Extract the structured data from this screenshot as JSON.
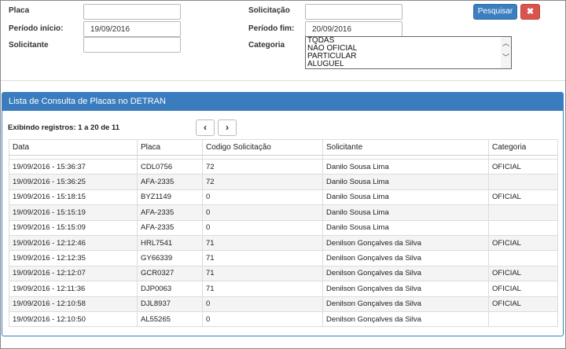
{
  "form": {
    "placa_label": "Placa",
    "placa_value": "",
    "periodo_inicio_label": "Período início:",
    "periodo_inicio_value": "19/09/2016",
    "solicitante_label": "Solicitante",
    "solicitante_value": "",
    "solicitacao_label": "Solicitação",
    "solicitacao_value": "",
    "periodo_fim_label": "Período fim:",
    "periodo_fim_value": "20/09/2016",
    "categoria_label": "Categoria",
    "categoria_options": [
      "TODAS",
      "NÃO OFICIAL",
      "PARTICULAR",
      "ALUGUEL"
    ],
    "search_label": "Pesquisar",
    "close_label": "✖"
  },
  "panel": {
    "title": "Lista de Consulta de Placas no DETRAN",
    "info": "Exibindo registros: 1 a 20 de 11",
    "prev_label": "‹",
    "next_label": "›"
  },
  "table": {
    "columns": [
      "Data",
      "Placa",
      "Codigo Solicitação",
      "Solicitante",
      "Categoria"
    ],
    "rows": [
      [
        "19/09/2016 - 15:36:37",
        "CDL0756",
        "72",
        "Danilo Sousa Lima",
        "OFICIAL"
      ],
      [
        "19/09/2016 - 15:36:25",
        "AFA-2335",
        "72",
        "Danilo Sousa Lima",
        ""
      ],
      [
        "19/09/2016 - 15:18:15",
        "BYZ1149",
        "0",
        "Danilo Sousa Lima",
        "OFICIAL"
      ],
      [
        "19/09/2016 - 15:15:19",
        "AFA-2335",
        "0",
        "Danilo Sousa Lima",
        ""
      ],
      [
        "19/09/2016 - 15:15:09",
        "AFA-2335",
        "0",
        "Danilo Sousa Lima",
        ""
      ],
      [
        "19/09/2016 - 12:12:46",
        "HRL7541",
        "71",
        "Denilson Gonçalves da Silva",
        "OFICIAL"
      ],
      [
        "19/09/2016 - 12:12:35",
        "GY66339",
        "71",
        "Denilson Gonçalves da Silva",
        ""
      ],
      [
        "19/09/2016 - 12:12:07",
        "GCR0327",
        "71",
        "Denilson Gonçalves da Silva",
        "OFICIAL"
      ],
      [
        "19/09/2016 - 12:11:36",
        "DJP0063",
        "71",
        "Denilson Gonçalves da Silva",
        "OFICIAL"
      ],
      [
        "19/09/2016 - 12:10:58",
        "DJL8937",
        "0",
        "Denilson Gonçalves da Silva",
        "OFICIAL"
      ],
      [
        "19/09/2016 - 12:10:50",
        "AL55265",
        "0",
        "Denilson Gonçalves da Silva",
        ""
      ]
    ]
  }
}
